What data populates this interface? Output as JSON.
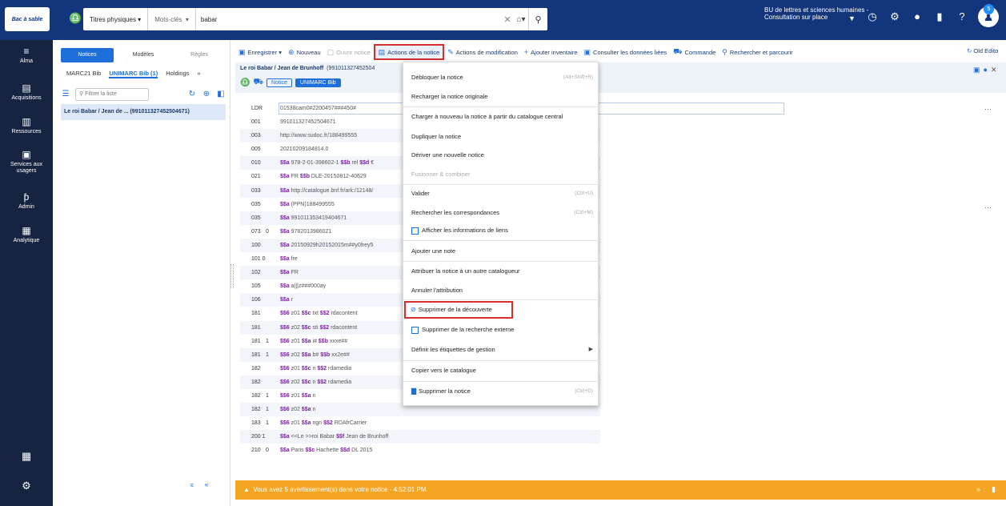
{
  "header": {
    "logo_text": "Bac à sable",
    "scope": "Titres physiques ▾",
    "field": "Mots-clés",
    "field_caret": "▾",
    "query": "babar",
    "institution": "BU de lettres et sciences humaines - Consultation sur place",
    "notification_count": "5"
  },
  "nav": [
    {
      "label": "Alma",
      "icon": "≡"
    },
    {
      "label": "Acquisitions",
      "icon": "▤"
    },
    {
      "label": "Ressources",
      "icon": "▥"
    },
    {
      "label": "Services aux usagers",
      "icon": "▣"
    },
    {
      "label": "Admin",
      "icon": "ƥ"
    },
    {
      "label": "Analytique",
      "icon": "▦"
    }
  ],
  "left_panel": {
    "tabs": [
      "Notices",
      "Modèles",
      "Règles"
    ],
    "subtabs": [
      "MARC21 Bib",
      "UNIMARC Bib (1)",
      "Holdings",
      "»"
    ],
    "filter_placeholder": "Filtrer la liste",
    "record": "Le roi Babar / Jean de ... (991011327452504671)"
  },
  "toolbar": {
    "save": "Enregistrer ▾",
    "new": "Nouveau",
    "open": "Ouvrir notice",
    "record_actions": "Actions de la notice",
    "edit_actions": "Actions de modification",
    "add_inventory": "Ajouter inventaire",
    "linked_data": "Consulter les données liées",
    "order": "Commande",
    "browse": "Rechercher et parcourir",
    "old_editor": "Old Edito"
  },
  "editor": {
    "title_bold": "Le roi Babar / Jean de Brunhoff",
    "title_id": "(991011327452504",
    "tag_notice": "Notice",
    "tag_format": "UNIMARC Bib"
  },
  "marc_rows": [
    {
      "tag": "LDR",
      "ind": "",
      "val": "01538cam0#2200457###450#"
    },
    {
      "tag": "001",
      "ind": "",
      "val": "991011327452504671"
    },
    {
      "tag": "003",
      "ind": "",
      "val": "http://www.sudoc.fr/188499555"
    },
    {
      "tag": "005",
      "ind": "",
      "val": "20210209184814.0"
    },
    {
      "tag": "010",
      "ind": "",
      "val": "$$a 978-2-01-398602-1 $$b rel $$d €"
    },
    {
      "tag": "021",
      "ind": "",
      "val": "$$a FR $$b DLE-20150812-40629"
    },
    {
      "tag": "033",
      "ind": "",
      "val": "$$a http://catalogue.bnf.fr/ark:/12148/"
    },
    {
      "tag": "035",
      "ind": "",
      "val": "$$a (PPN)188499555"
    },
    {
      "tag": "035",
      "ind": "",
      "val": "$$a 991011353419404671"
    },
    {
      "tag": "073",
      "ind": "0",
      "val": "$$a 9782013986021"
    },
    {
      "tag": "100",
      "ind": "",
      "val": "$$a 20150929h20152015m##y0frey5"
    },
    {
      "tag": "101 0",
      "ind": "",
      "val": "$$a fre"
    },
    {
      "tag": "102",
      "ind": "",
      "val": "$$a FR"
    },
    {
      "tag": "105",
      "ind": "",
      "val": "$$a a|||z###000ay"
    },
    {
      "tag": "106",
      "ind": "",
      "val": "$$a r"
    },
    {
      "tag": "181",
      "ind": "",
      "val": "$$6 z01 $$c txt $$2 rdacontent"
    },
    {
      "tag": "181",
      "ind": "",
      "val": "$$6 z02 $$c sti $$2 rdacontent"
    },
    {
      "tag": "181",
      "ind": "1",
      "val": "$$6 z01 $$a i# $$b xxxe##"
    },
    {
      "tag": "181",
      "ind": "1",
      "val": "$$6 z02 $$a b# $$b xx2e##"
    },
    {
      "tag": "182",
      "ind": "",
      "val": "$$6 z01 $$c n $$2 rdamedia"
    },
    {
      "tag": "182",
      "ind": "",
      "val": "$$6 z02 $$c n $$2 rdamedia"
    },
    {
      "tag": "182",
      "ind": "1",
      "val": "$$6 z01 $$a n"
    },
    {
      "tag": "182",
      "ind": "1",
      "val": "$$6 z02 $$a n"
    },
    {
      "tag": "183",
      "ind": "1",
      "val": "$$6 z01 $$a ngn $$2 RDAfrCarrier"
    },
    {
      "tag": "200 1",
      "ind": "",
      "val": "$$a <<Le >>roi Babar $$f Jean de Brunhoff"
    },
    {
      "tag": "210",
      "ind": "0",
      "val": "$$a Paris $$c Hachette $$d DL 2015"
    }
  ],
  "menu": [
    {
      "label": "Débloquer la notice",
      "shortcut": "(Alt+Shift+R)"
    },
    {
      "label": "Recharger la notice originale"
    },
    {
      "label": "Charger à nouveau la notice à partir du catalogue central"
    },
    {
      "label": "Dupliquer la notice"
    },
    {
      "label": "Dériver une nouvelle notice"
    },
    {
      "label": "Fusionner & combiner",
      "disabled": true
    },
    {
      "label": "Valider",
      "shortcut": "(Ctrl+U)"
    },
    {
      "label": "Rechercher les correspondances",
      "shortcut": "(Ctrl+M)"
    },
    {
      "label": "Afficher les informations de liens"
    },
    {
      "label": "Ajouter une note"
    },
    {
      "label": "Attribuer la notice à un autre catalogueur"
    },
    {
      "label": "Annuler l'attribution"
    },
    {
      "label": "Supprimer de la découverte"
    },
    {
      "label": "Supprimer de la recherche externe"
    },
    {
      "label": "Définir les étiquettes de gestion"
    },
    {
      "label": "Copier vers le catalogue"
    },
    {
      "label": "Supprimer la notice",
      "shortcut": "(Ctrl+D)"
    }
  ],
  "warning": "Vous avez 5 avertissement(s) dans votre notice - 4:52:01 PM.",
  "colors": {
    "topbar": "#13357c",
    "leftnav": "#162341",
    "accent": "#1e6fd9",
    "highlight": "#d32f2f",
    "warning": "#f4a623"
  }
}
